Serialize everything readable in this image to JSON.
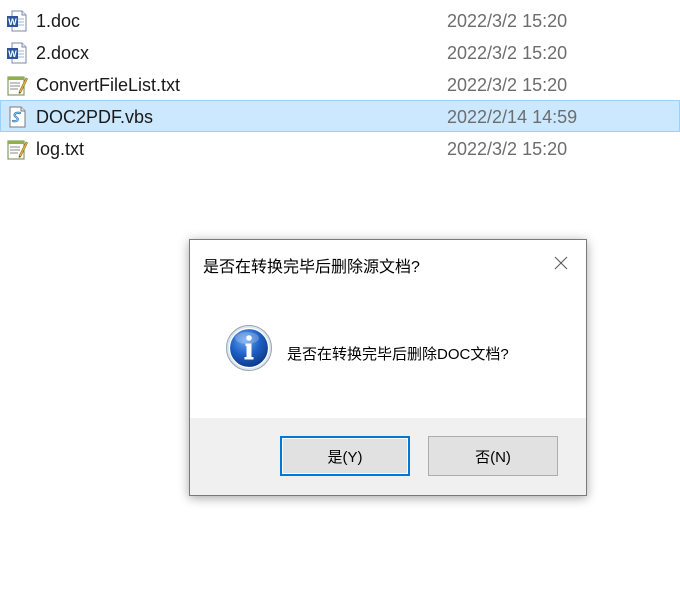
{
  "files": [
    {
      "name": "1.doc",
      "date": "2022/3/2 15:20",
      "icon": "word-doc-icon",
      "selected": false
    },
    {
      "name": "2.docx",
      "date": "2022/3/2 15:20",
      "icon": "word-doc-icon",
      "selected": false
    },
    {
      "name": "ConvertFileList.txt",
      "date": "2022/3/2 15:20",
      "icon": "text-file-icon",
      "selected": false
    },
    {
      "name": "DOC2PDF.vbs",
      "date": "2022/2/14 14:59",
      "icon": "vbs-script-icon",
      "selected": true
    },
    {
      "name": "log.txt",
      "date": "2022/3/2 15:20",
      "icon": "text-file-icon",
      "selected": false
    }
  ],
  "dialog": {
    "title": "是否在转换完毕后删除源文档?",
    "message": "是否在转换完毕后删除DOC文档?",
    "icon": "info-icon",
    "yes_label": "是(Y)",
    "no_label": "否(N)"
  },
  "colors": {
    "selection_bg": "#cce8ff",
    "selection_border": "#99d1ff",
    "button_focus": "#0078d7",
    "footer_bg": "#f0f0f0"
  }
}
